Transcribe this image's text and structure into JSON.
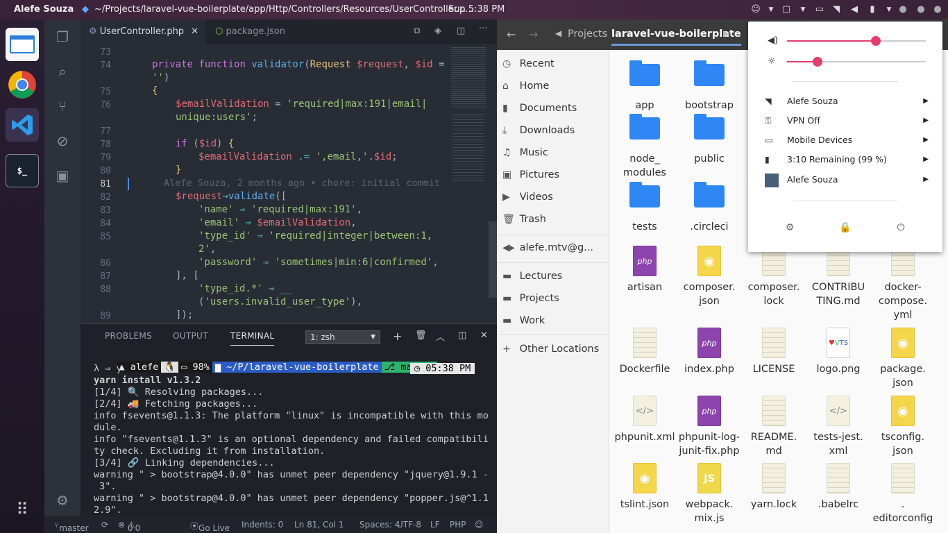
{
  "topbar": {
    "user": "Alefe Souza",
    "window_title": "~/Projects/laravel-vue-boilerplate/app/Http/Controllers/Resources/UserController.p...",
    "clock": "Sun  5:38 PM"
  },
  "dock": {
    "terminal_label": "$_"
  },
  "vscode": {
    "tabs": [
      "UserController.php",
      "package.json"
    ],
    "lines": [
      {
        "n": "73"
      },
      {
        "n": "74"
      },
      {
        "n": ""
      },
      {
        "n": "75"
      },
      {
        "n": "76"
      },
      {
        "n": ""
      },
      {
        "n": "77"
      },
      {
        "n": "78"
      },
      {
        "n": "79"
      },
      {
        "n": "80"
      },
      {
        "n": "81"
      },
      {
        "n": "82"
      },
      {
        "n": "83"
      },
      {
        "n": "84"
      },
      {
        "n": "85"
      },
      {
        "n": ""
      },
      {
        "n": "86"
      },
      {
        "n": "87"
      },
      {
        "n": "88"
      },
      {
        "n": ""
      },
      {
        "n": "89"
      }
    ],
    "blame": "Alefe Souza, 2 months ago • chore: initial commit",
    "panel_tabs": [
      "PROBLEMS",
      "OUTPUT",
      "TERMINAL"
    ],
    "terminal_select": "1: zsh",
    "prompt": {
      "user": "alefe",
      "battery": "98%",
      "path": "~/P/laravel-vue-boilerplate",
      "branch": "master",
      "time": "05:38 PM",
      "command": "λ ⇒ y"
    },
    "terminal_lines": [
      "yarn install v1.3.2",
      "[1/4] 🔍 Resolving packages...",
      "[2/4] 🚚 Fetching packages...",
      "info fsevents@1.1.3: The platform \"linux\" is incompatible with this mo",
      "dule.",
      "info \"fsevents@1.1.3\" is an optional dependency and failed compatibili",
      "ty check. Excluding it from installation.",
      "[3/4] 🔗 Linking dependencies...",
      "warning \" > bootstrap@4.0.0\" has unmet peer dependency \"jquery@1.9.1 -",
      " 3\".",
      "warning \" > bootstrap@4.0.0\" has unmet peer dependency \"popper.js@^1.1",
      "2.9\"."
    ],
    "status": {
      "branch": "master",
      "errors": "0",
      "warnings": "0",
      "golive": "Go Live",
      "indents": "Indents: 0",
      "position": "Ln 81, Col 1",
      "spaces": "Spaces: 4",
      "encoding": "UTF-8",
      "eol": "LF",
      "language": "PHP"
    }
  },
  "files": {
    "breadcrumb": [
      "Projects",
      "laravel-vue-boilerplate"
    ],
    "sidebar": [
      "Recent",
      "Home",
      "Documents",
      "Downloads",
      "Music",
      "Pictures",
      "Videos",
      "Trash",
      "alefe.mtv@g...",
      "Lectures",
      "Projects",
      "Work",
      "Other Locations"
    ],
    "items": [
      {
        "name": "app",
        "kind": "folder"
      },
      {
        "name": "bootstrap",
        "kind": "folder"
      },
      {
        "name": "node_\nmodules",
        "kind": "folder"
      },
      {
        "name": "public",
        "kind": "folder"
      },
      {
        "name": "tests",
        "kind": "folder"
      },
      {
        "name": ".circleci",
        "kind": "folder"
      },
      {
        "name": "artisan",
        "kind": "php"
      },
      {
        "name": "composer.\njson",
        "kind": "json"
      },
      {
        "name": "composer.\nlock",
        "kind": "text"
      },
      {
        "name": "CONTRIBU\nTING.md",
        "kind": "text"
      },
      {
        "name": "docker-\ncompose.\nyml",
        "kind": "text"
      },
      {
        "name": "Dockerfile",
        "kind": "text"
      },
      {
        "name": "index.php",
        "kind": "php"
      },
      {
        "name": "LICENSE",
        "kind": "text"
      },
      {
        "name": "logo.png",
        "kind": "image"
      },
      {
        "name": "package.\njson",
        "kind": "json"
      },
      {
        "name": "phpunit.xml",
        "kind": "xml"
      },
      {
        "name": "phpunit-log-\njunit-fix.php",
        "kind": "php"
      },
      {
        "name": "README.\nmd",
        "kind": "text"
      },
      {
        "name": "tests-jest.\nxml",
        "kind": "xml"
      },
      {
        "name": "tsconfig.\njson",
        "kind": "json"
      },
      {
        "name": "tslint.json",
        "kind": "json"
      },
      {
        "name": "webpack.\nmix.js",
        "kind": "js"
      },
      {
        "name": "yarn.lock",
        "kind": "text"
      },
      {
        "name": ".babelrc",
        "kind": "text"
      },
      {
        "name": ".\neditorconfig",
        "kind": "text"
      }
    ]
  },
  "popup": {
    "volume_level": 0.64,
    "brightness_level": 0.22,
    "items": [
      "Alefe Souza",
      "VPN Off",
      "Mobile Devices",
      "3:10 Remaining (99 %)",
      "Alefe Souza"
    ]
  },
  "colors": {
    "accent": "#e63d6e",
    "folder": "#2f87f5",
    "vscode_bg": "#282c34"
  }
}
